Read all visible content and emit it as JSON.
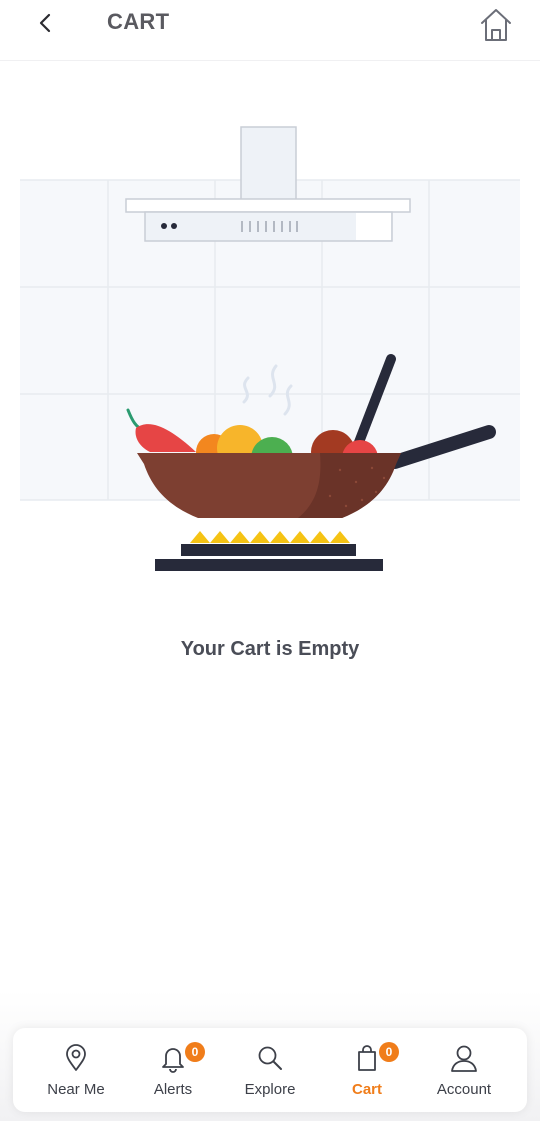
{
  "header": {
    "title": "CART"
  },
  "empty_state": {
    "message": "Your Cart is Empty"
  },
  "bottom_nav": {
    "items": [
      {
        "label": "Near Me",
        "icon": "map-pin-icon"
      },
      {
        "label": "Alerts",
        "icon": "bell-icon",
        "badge": "0"
      },
      {
        "label": "Explore",
        "icon": "search-icon"
      },
      {
        "label": "Cart",
        "icon": "shopping-bag-icon",
        "badge": "0",
        "active": true
      },
      {
        "label": "Account",
        "icon": "user-icon"
      }
    ],
    "active_color": "#f07d1a"
  }
}
